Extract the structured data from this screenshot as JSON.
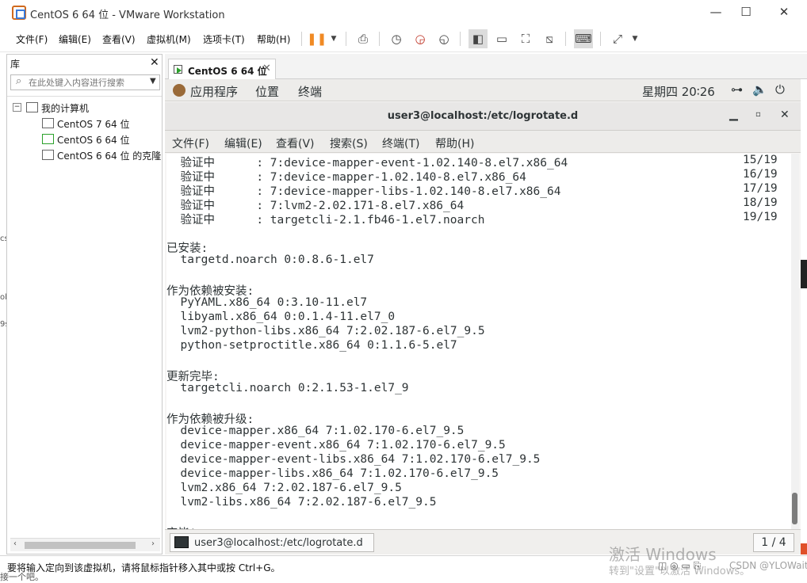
{
  "window": {
    "title": "CentOS 6 64 位 - VMware Workstation",
    "minimize": "—",
    "maximize": "☐",
    "close": "✕"
  },
  "menubar": {
    "file": "文件(F)",
    "edit": "编辑(E)",
    "view": "查看(V)",
    "vm": "虚拟机(M)",
    "tabs": "选项卡(T)",
    "help": "帮助(H)"
  },
  "library": {
    "title": "库",
    "close": "✕",
    "search_placeholder": "在此处键入内容进行搜索",
    "tree": {
      "root": "我的计算机",
      "root_toggle": "−",
      "items": [
        "CentOS 7 64 位",
        "CentOS 6 64 位",
        "CentOS 6 64 位 的克隆"
      ]
    }
  },
  "tab": {
    "label": "CentOS 6 64 位",
    "close": "✕"
  },
  "gnome": {
    "applications": "应用程序",
    "places": "位置",
    "terminal": "终端",
    "clock": "星期四 20∶26"
  },
  "terminal": {
    "title": "user3@localhost:/etc/logrotate.d",
    "menu": [
      "文件(F)",
      "编辑(E)",
      "查看(V)",
      "搜索(S)",
      "终端(T)",
      "帮助(H)"
    ],
    "lines": [
      {
        "text": "  验证中      : 7:device-mapper-event-1.02.140-8.el7.x86_64",
        "right": "15/19"
      },
      {
        "text": "  验证中      : 7:device-mapper-1.02.140-8.el7.x86_64",
        "right": "16/19"
      },
      {
        "text": "  验证中      : 7:device-mapper-libs-1.02.140-8.el7.x86_64",
        "right": "17/19"
      },
      {
        "text": "  验证中      : 7:lvm2-2.02.171-8.el7.x86_64",
        "right": "18/19"
      },
      {
        "text": "  验证中      : targetcli-2.1.fb46-1.el7.noarch",
        "right": "19/19"
      },
      {
        "text": "",
        "right": ""
      },
      {
        "text": "已安装:",
        "right": ""
      },
      {
        "text": "  targetd.noarch 0:0.8.6-1.el7",
        "right": ""
      },
      {
        "text": "",
        "right": ""
      },
      {
        "text": "作为依赖被安装:",
        "right": ""
      },
      {
        "text": "  PyYAML.x86_64 0:3.10-11.el7",
        "right": ""
      },
      {
        "text": "  libyaml.x86_64 0:0.1.4-11.el7_0",
        "right": ""
      },
      {
        "text": "  lvm2-python-libs.x86_64 7:2.02.187-6.el7_9.5",
        "right": ""
      },
      {
        "text": "  python-setproctitle.x86_64 0:1.1.6-5.el7",
        "right": ""
      },
      {
        "text": "",
        "right": ""
      },
      {
        "text": "更新完毕:",
        "right": ""
      },
      {
        "text": "  targetcli.noarch 0:2.1.53-1.el7_9",
        "right": ""
      },
      {
        "text": "",
        "right": ""
      },
      {
        "text": "作为依赖被升级:",
        "right": ""
      },
      {
        "text": "  device-mapper.x86_64 7:1.02.170-6.el7_9.5",
        "right": ""
      },
      {
        "text": "  device-mapper-event.x86_64 7:1.02.170-6.el7_9.5",
        "right": ""
      },
      {
        "text": "  device-mapper-event-libs.x86_64 7:1.02.170-6.el7_9.5",
        "right": ""
      },
      {
        "text": "  device-mapper-libs.x86_64 7:1.02.170-6.el7_9.5",
        "right": ""
      },
      {
        "text": "  lvm2.x86_64 7:2.02.187-6.el7_9.5",
        "right": ""
      },
      {
        "text": "  lvm2-libs.x86_64 7:2.02.187-6.el7_9.5",
        "right": ""
      },
      {
        "text": "",
        "right": ""
      },
      {
        "text": "完毕!",
        "right": ""
      }
    ],
    "task_label": "user3@localhost:/etc/logrotate.d",
    "pager": "1 / 4"
  },
  "statusbar": {
    "text": "要将输入定向到该虚拟机，请将鼠标指针移入其中或按 Ctrl+G。",
    "fragment_left": "接一个吧。",
    "watermark_line1": "激活 Windows",
    "watermark_line2": "转到\"设置\"以激活 Windows。",
    "credit": "CSDN @YLOWaitinG"
  },
  "host_left_fragments": [
    "cs",
    "ol",
    "9s"
  ],
  "colors": {
    "accent_orange": "#f08a24",
    "guest_bg": "#f6f5f4",
    "terminal_fg": "#2e3436"
  }
}
